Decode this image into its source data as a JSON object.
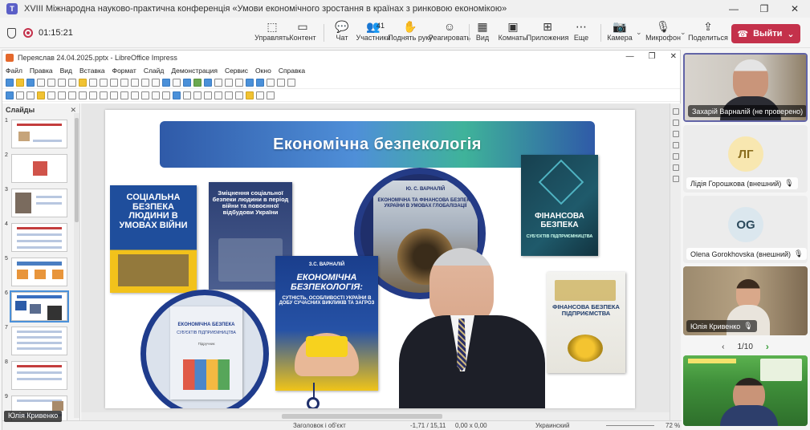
{
  "window": {
    "title": "XVIII Міжнародна науково-практична конференція «Умови економічного зростання в країнах з ринковою економікою»",
    "controls": [
      "—",
      "❐",
      "✕"
    ]
  },
  "meeting": {
    "timer": "01:15:21",
    "tools": [
      {
        "icon": "⬚",
        "label": "Управлять"
      },
      {
        "icon": "▭",
        "label": "Контент"
      },
      {
        "icon": "💬",
        "label": "Чат"
      },
      {
        "icon": "👥",
        "label": "Участники",
        "badge": "41"
      },
      {
        "icon": "✋",
        "label": "Поднять руку"
      },
      {
        "icon": "☺",
        "label": "Реагировать"
      },
      {
        "icon": "▦",
        "label": "Вид"
      },
      {
        "icon": "▣",
        "label": "Комнаты"
      },
      {
        "icon": "⊞",
        "label": "Приложения"
      },
      {
        "icon": "⋯",
        "label": "Еще"
      },
      {
        "icon": "📷",
        "label": "Камера"
      },
      {
        "icon": "🎙",
        "label": "Микрофон"
      },
      {
        "icon": "⇪",
        "label": "Поделиться"
      }
    ],
    "leave_label": "Выйти"
  },
  "impress": {
    "title": "Переяслав 24.04.2025.pptx - LibreOffice Impress",
    "menu": [
      "Файл",
      "Правка",
      "Вид",
      "Вставка",
      "Формат",
      "Слайд",
      "Демонстрация",
      "Сервис",
      "Окно",
      "Справка"
    ],
    "slides_panel_title": "Слайды",
    "slide_numbers": [
      "1",
      "2",
      "3",
      "4",
      "5",
      "6",
      "7",
      "8",
      "9"
    ],
    "active_slide": 6,
    "slide": {
      "title": "Економічна безпекологія",
      "books": [
        {
          "text": "СОЦІАЛЬНА БЕЗПЕКА ЛЮДИНИ В УМОВАХ ВІЙНИ"
        },
        {
          "text": "Зміцнення соціальної безпеки людини в період війни та повоєнної відбудови України"
        },
        {
          "text": "Ю. С. ВАРНАЛІЙ"
        },
        {
          "text": "ЕКОНОМІЧНА ТА ФІНАНСОВА БЕЗПЕКА УКРАЇНИ В УМОВАХ ГЛОБАЛІЗАЦІЇ"
        },
        {
          "text": "ФІНАНСОВА БЕЗПЕКА"
        },
        {
          "text": "СУБ'ЄКТІВ ПІДПРИЄМНИЦТВА"
        },
        {
          "text": "З.С. ВАРНАЛІЙ"
        },
        {
          "text": "ЕКОНОМІЧНА БЕЗПЕКОЛОГІЯ:"
        },
        {
          "text": "СУТНІСТЬ, ОСОБЛИВОСТІ УКРАЇНИ В ДОБУ СУЧАСНИХ ВИКЛИКІВ ТА ЗАГРОЗ"
        },
        {
          "text": "ЕКОНОМІЧНА БЕЗПЕКА"
        },
        {
          "text": "СУБ'ЄКТІВ ПІДПРИЄМНИЦТВА"
        },
        {
          "text": "Підручник"
        },
        {
          "text": "ФІНАНСОВА БЕЗПЕКА ПІДПРИЄМСТВА"
        }
      ]
    },
    "status": {
      "layout": "Заголовок і об'єкт",
      "position": "-1,71 / 15,11",
      "size": "0,00 x 0,00",
      "language": "Украинский",
      "zoom": "72 %"
    }
  },
  "sharer": "Юлія Кривенко",
  "participants": [
    {
      "name": "Захарій Варналій (не проверено)",
      "initials": ""
    },
    {
      "name": "Лідія Горошкова (внешний)",
      "initials": "ЛГ",
      "color": "#f8e7b0",
      "text_color": "#8a6d1d"
    },
    {
      "name": "Olena Gorokhovska (внешний)",
      "initials": "OG",
      "color": "#dbe7ee",
      "text_color": "#2c4a5c"
    },
    {
      "name": "Юлія Кривенко",
      "initials": ""
    }
  ],
  "pager": "1/10"
}
